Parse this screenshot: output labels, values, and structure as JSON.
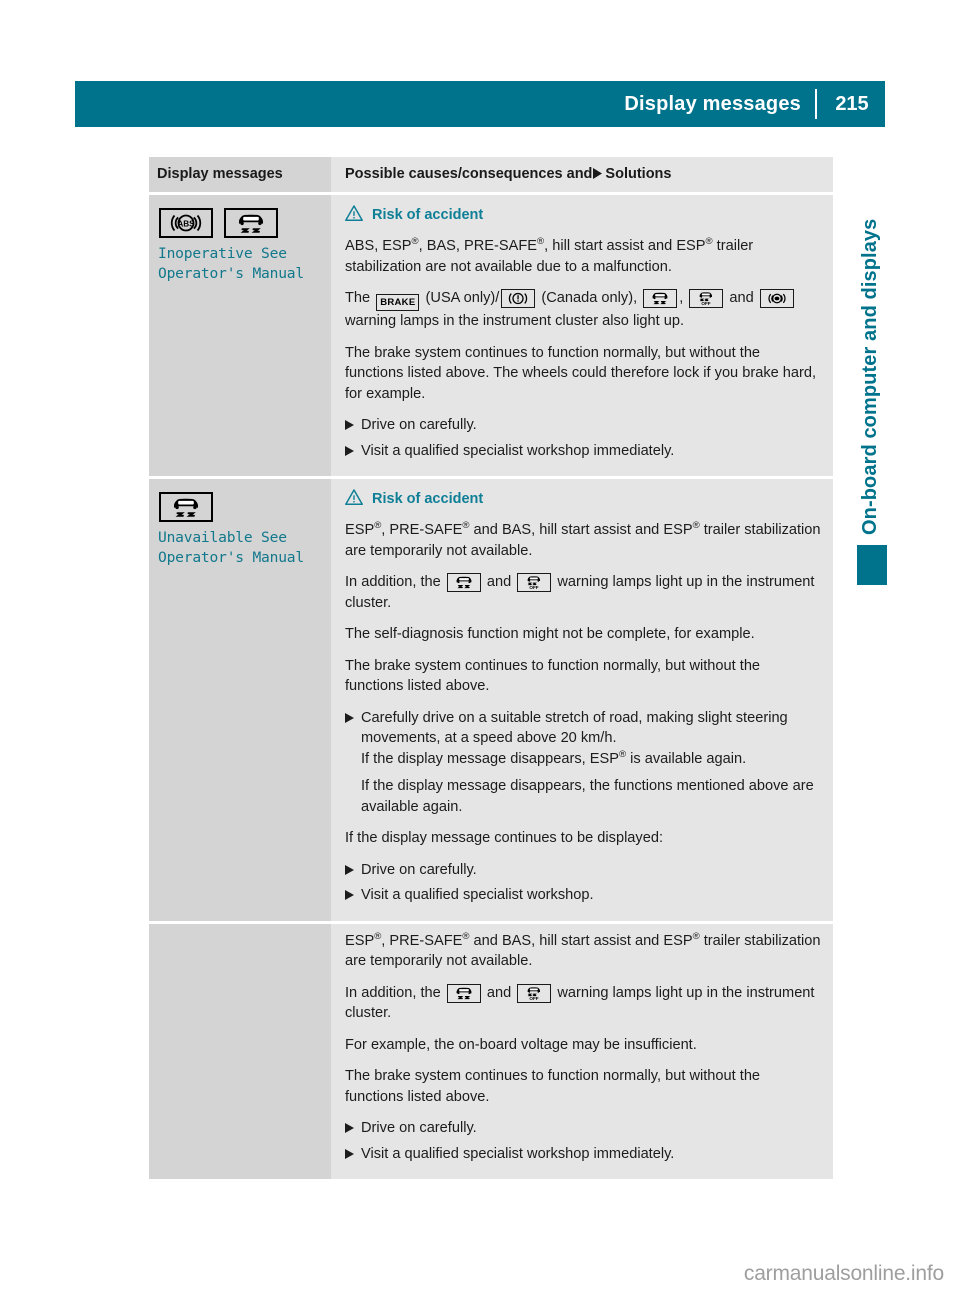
{
  "header": {
    "title": "Display messages",
    "page_number": "215"
  },
  "side_label": "On-board computer and displays",
  "watermark": "carmanualsonline.info",
  "colors": {
    "accent_teal": "#00738c",
    "message_teal": "#12788c",
    "col_left_bg": "#d4d4d4",
    "col_right_bg": "#e5e5e5"
  },
  "table": {
    "headers": {
      "left": "Display messages",
      "right_before": "Possible causes/consequences and",
      "right_after": "Solutions"
    },
    "rows": [
      {
        "icons": [
          "abs-warning-lamp-icon",
          "esp-skid-warning-lamp-icon"
        ],
        "message_line1": "Inoperative See",
        "message_line2": "Operator's Manual",
        "warning_heading": "Risk of accident",
        "paragraphs": [
          "ABS, ESP®, BAS, PRE-SAFE®, hill start assist and ESP® trailer stabilization are not available due to a malfunction.",
          "The BRAKE (USA only)/ (!) (Canada only), (esp), (esp-off) and (abs) warning lamps in the instrument cluster also light up.",
          "The brake system continues to function normally, but without the functions listed above. The wheels could therefore lock if you brake hard, for example."
        ],
        "bullets": [
          "Drive on carefully.",
          "Visit a qualified specialist workshop immediately."
        ]
      },
      {
        "icons": [
          "esp-skid-warning-lamp-icon"
        ],
        "message_line1": "Unavailable See",
        "message_line2": "Operator's Manual",
        "warning_heading": "Risk of accident",
        "paragraphs": [
          "ESP®, PRE-SAFE® and BAS, hill start assist and ESP® trailer stabilization are temporarily not available.",
          "In addition, the (esp) and (esp-off) warning lamps light up in the instrument cluster.",
          "The self-diagnosis function might not be complete, for example.",
          "The brake system continues to function normally, but without the functions listed above."
        ],
        "bullet_main": "Carefully drive on a suitable stretch of road, making slight steering movements, at a speed above 20 km/h.",
        "bullet_sub1": "If the display message disappears, ESP® is available again.",
        "bullet_sub2": "If the display message disappears, the functions mentioned above are available again.",
        "closing_intro": "If the display message continues to be displayed:",
        "bullets": [
          "Drive on carefully.",
          "Visit a qualified specialist workshop."
        ]
      },
      {
        "icons": [],
        "paragraphs": [
          "ESP®, PRE-SAFE® and BAS, hill start assist and ESP® trailer stabilization are temporarily not available.",
          "In addition, the (esp) and (esp-off) warning lamps light up in the instrument cluster.",
          "For example, the on-board voltage may be insufficient.",
          "The brake system continues to function normally, but without the functions listed above."
        ],
        "bullets": [
          "Drive on carefully.",
          "Visit a qualified specialist workshop immediately."
        ]
      }
    ]
  },
  "text_fragments": {
    "abs_esp_bas_pre_safe_a": "ABS, ESP",
    "bas_pre_safe_b": ", BAS, PRE-SAFE",
    "hill_start_tail": ", hill start assist and ESP",
    "trailer_tail": " trailer stabilization are not available due to a malfunction.",
    "the_word": "The ",
    "brake_label": "BRAKE",
    "usa_only": " (USA only)/",
    "canada_only": " (Canada only), ",
    "comma": ", ",
    "and_word": " and ",
    "warning_lamps_tail": " warning lamps in the instrument cluster also light up.",
    "brake_system_para": "The brake system continues to function normally, but without the functions listed above. The wheels could therefore lock if you brake hard, for example.",
    "esp_start": "ESP",
    "pre_safe_and_bas": ", PRE-SAFE",
    "and_bas_hill": " and BAS, hill start assist and ESP",
    "trailer_temp_tail": " trailer stabilization are temporarily not available.",
    "in_addition": "In addition, the ",
    "warning_lamps_light_up": " warning lamps light up in the instrument cluster.",
    "self_diagnosis": "The self-diagnosis function might not be complete, for example.",
    "brake_system_short": "The brake system continues to function normally, but without the functions listed above.",
    "carefully_drive": "Carefully drive on a suitable stretch of road, making slight steering movements, at a speed above 20 km/h.",
    "disappears_esp_a": "If the display message disappears, ESP",
    "disappears_esp_b": " is available again.",
    "disappears_functions": "If the display message disappears, the functions mentioned above are available again.",
    "continues_displayed": "If the display message continues to be displayed:",
    "drive_on_carefully": "Drive on carefully.",
    "visit_workshop": "Visit a qualified specialist workshop.",
    "visit_workshop_imm": "Visit a qualified specialist workshop immediately.",
    "onboard_voltage": "For example, the on-board voltage may be insufficient."
  }
}
